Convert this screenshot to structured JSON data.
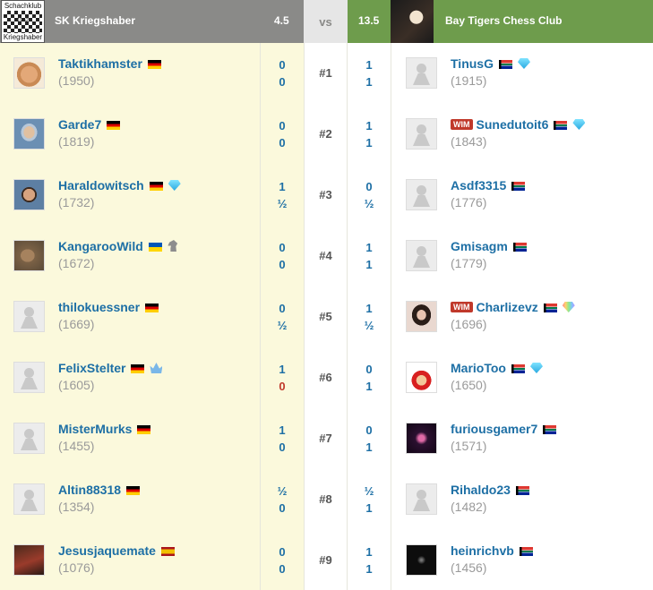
{
  "header": {
    "left_club": {
      "name": "SK Kriegshaber",
      "score": "4.5",
      "logo_top": "Schachklub",
      "logo_bottom": "Kriegshaber",
      "logo_year": "19 52"
    },
    "vs": "vs",
    "right_club": {
      "name": "Bay Tigers Chess Club",
      "score": "13.5"
    }
  },
  "boards": [
    {
      "board": "#1",
      "left": {
        "name": "Taktikhamster",
        "rating": "(1950)",
        "flag": "de",
        "avatar": "hamster",
        "scores": [
          "0",
          "0"
        ]
      },
      "right": {
        "name": "TinusG",
        "rating": "(1915)",
        "flag": "za",
        "badge": "diamond",
        "avatar": "pawn",
        "scores": [
          "1",
          "1"
        ]
      }
    },
    {
      "board": "#2",
      "left": {
        "name": "Garde7",
        "rating": "(1819)",
        "flag": "de",
        "avatar": "garde",
        "scores": [
          "0",
          "0"
        ]
      },
      "right": {
        "title": "WIM",
        "name": "Sunedutoit6",
        "rating": "(1843)",
        "flag": "za",
        "badge": "diamond",
        "avatar": "pawn",
        "scores": [
          "1",
          "1"
        ]
      }
    },
    {
      "board": "#3",
      "left": {
        "name": "Haraldowitsch",
        "rating": "(1732)",
        "flag": "de",
        "badge": "diamond",
        "avatar": "harald",
        "scores": [
          "1",
          "½"
        ]
      },
      "right": {
        "name": "Asdf3315",
        "rating": "(1776)",
        "flag": "za",
        "avatar": "pawn",
        "scores": [
          "0",
          "½"
        ]
      }
    },
    {
      "board": "#4",
      "left": {
        "name": "KangarooWild",
        "rating": "(1672)",
        "flag": "ua",
        "badge": "knight",
        "avatar": "kangaroo",
        "scores": [
          "0",
          "0"
        ]
      },
      "right": {
        "name": "Gmisagm",
        "rating": "(1779)",
        "flag": "za",
        "avatar": "pawn",
        "scores": [
          "1",
          "1"
        ]
      }
    },
    {
      "board": "#5",
      "left": {
        "name": "thilokuessner",
        "rating": "(1669)",
        "flag": "de",
        "avatar": "pawn",
        "scores": [
          "0",
          "½"
        ]
      },
      "right": {
        "title": "WIM",
        "name": "Charlizevz",
        "rating": "(1696)",
        "flag": "za",
        "badge": "rainbow-diamond",
        "avatar": "charli",
        "scores": [
          "1",
          "½"
        ]
      }
    },
    {
      "board": "#6",
      "left": {
        "name": "FelixStelter",
        "rating": "(1605)",
        "flag": "de",
        "badge": "crown",
        "avatar": "pawn",
        "scores": [
          "1",
          "0"
        ]
      },
      "right": {
        "name": "MarioToo",
        "rating": "(1650)",
        "flag": "za",
        "badge": "diamond",
        "avatar": "mario",
        "scores": [
          "0",
          "1"
        ]
      }
    },
    {
      "board": "#7",
      "left": {
        "name": "MisterMurks",
        "rating": "(1455)",
        "flag": "de",
        "avatar": "pawn",
        "scores": [
          "1",
          "0"
        ]
      },
      "right": {
        "name": "furiousgamer7",
        "rating": "(1571)",
        "flag": "za",
        "avatar": "furious",
        "scores": [
          "0",
          "1"
        ]
      }
    },
    {
      "board": "#8",
      "left": {
        "name": "Altin88318",
        "rating": "(1354)",
        "flag": "de",
        "avatar": "pawn",
        "scores": [
          "½",
          "0"
        ]
      },
      "right": {
        "name": "Rihaldo23",
        "rating": "(1482)",
        "flag": "za",
        "avatar": "pawn",
        "scores": [
          "½",
          "1"
        ]
      }
    },
    {
      "board": "#9",
      "left": {
        "name": "Jesusjaquemate",
        "rating": "(1076)",
        "flag": "es",
        "avatar": "jesus",
        "scores": [
          "0",
          "0"
        ]
      },
      "right": {
        "name": "heinrichvb",
        "rating": "(1456)",
        "flag": "za",
        "avatar": "heinrich",
        "scores": [
          "1",
          "1"
        ]
      }
    }
  ],
  "colors": {
    "left_header": "#8a8a88",
    "right_header": "#6e9c4c",
    "link": "#1d6fa5",
    "loss_red": "#c0392b",
    "left_bg": "#fbf9dc"
  }
}
